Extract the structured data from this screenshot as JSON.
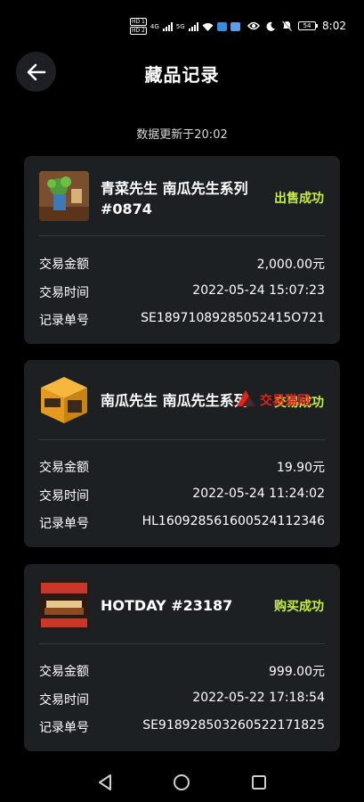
{
  "status_bar": {
    "sim1": "HD 1",
    "sim2": "HD 2",
    "net1": "4G",
    "net2": "5G",
    "battery": "54",
    "time": "8:02"
  },
  "header": {
    "title": "藏品记录",
    "back_icon": "arrow-left-icon"
  },
  "updated_text": "数据更新于20:02",
  "labels": {
    "amount": "交易金额",
    "time": "交易时间",
    "order": "记录单号"
  },
  "records": [
    {
      "name": "青菜先生 南瓜先生系列 #0874",
      "status": "出售成功",
      "amount": "2,000.00元",
      "time": "2022-05-24 15:07:23",
      "order": "SE18971089285052415O721"
    },
    {
      "name": "南瓜先生 南瓜先生系列",
      "status": "交易成功",
      "amount": "19.90元",
      "time": "2022-05-24 11:24:02",
      "order": "HL160928561600524112346"
    },
    {
      "name": "HOTDAY #23187",
      "status": "购买成功",
      "amount": "999.00元",
      "time": "2022-05-22 17:18:54",
      "order": "SE918928503260522171825"
    }
  ],
  "watermark": "交易猫网",
  "colors": {
    "background": "#000000",
    "card": "#1d2023",
    "status_accent": "#c6ef3e"
  }
}
